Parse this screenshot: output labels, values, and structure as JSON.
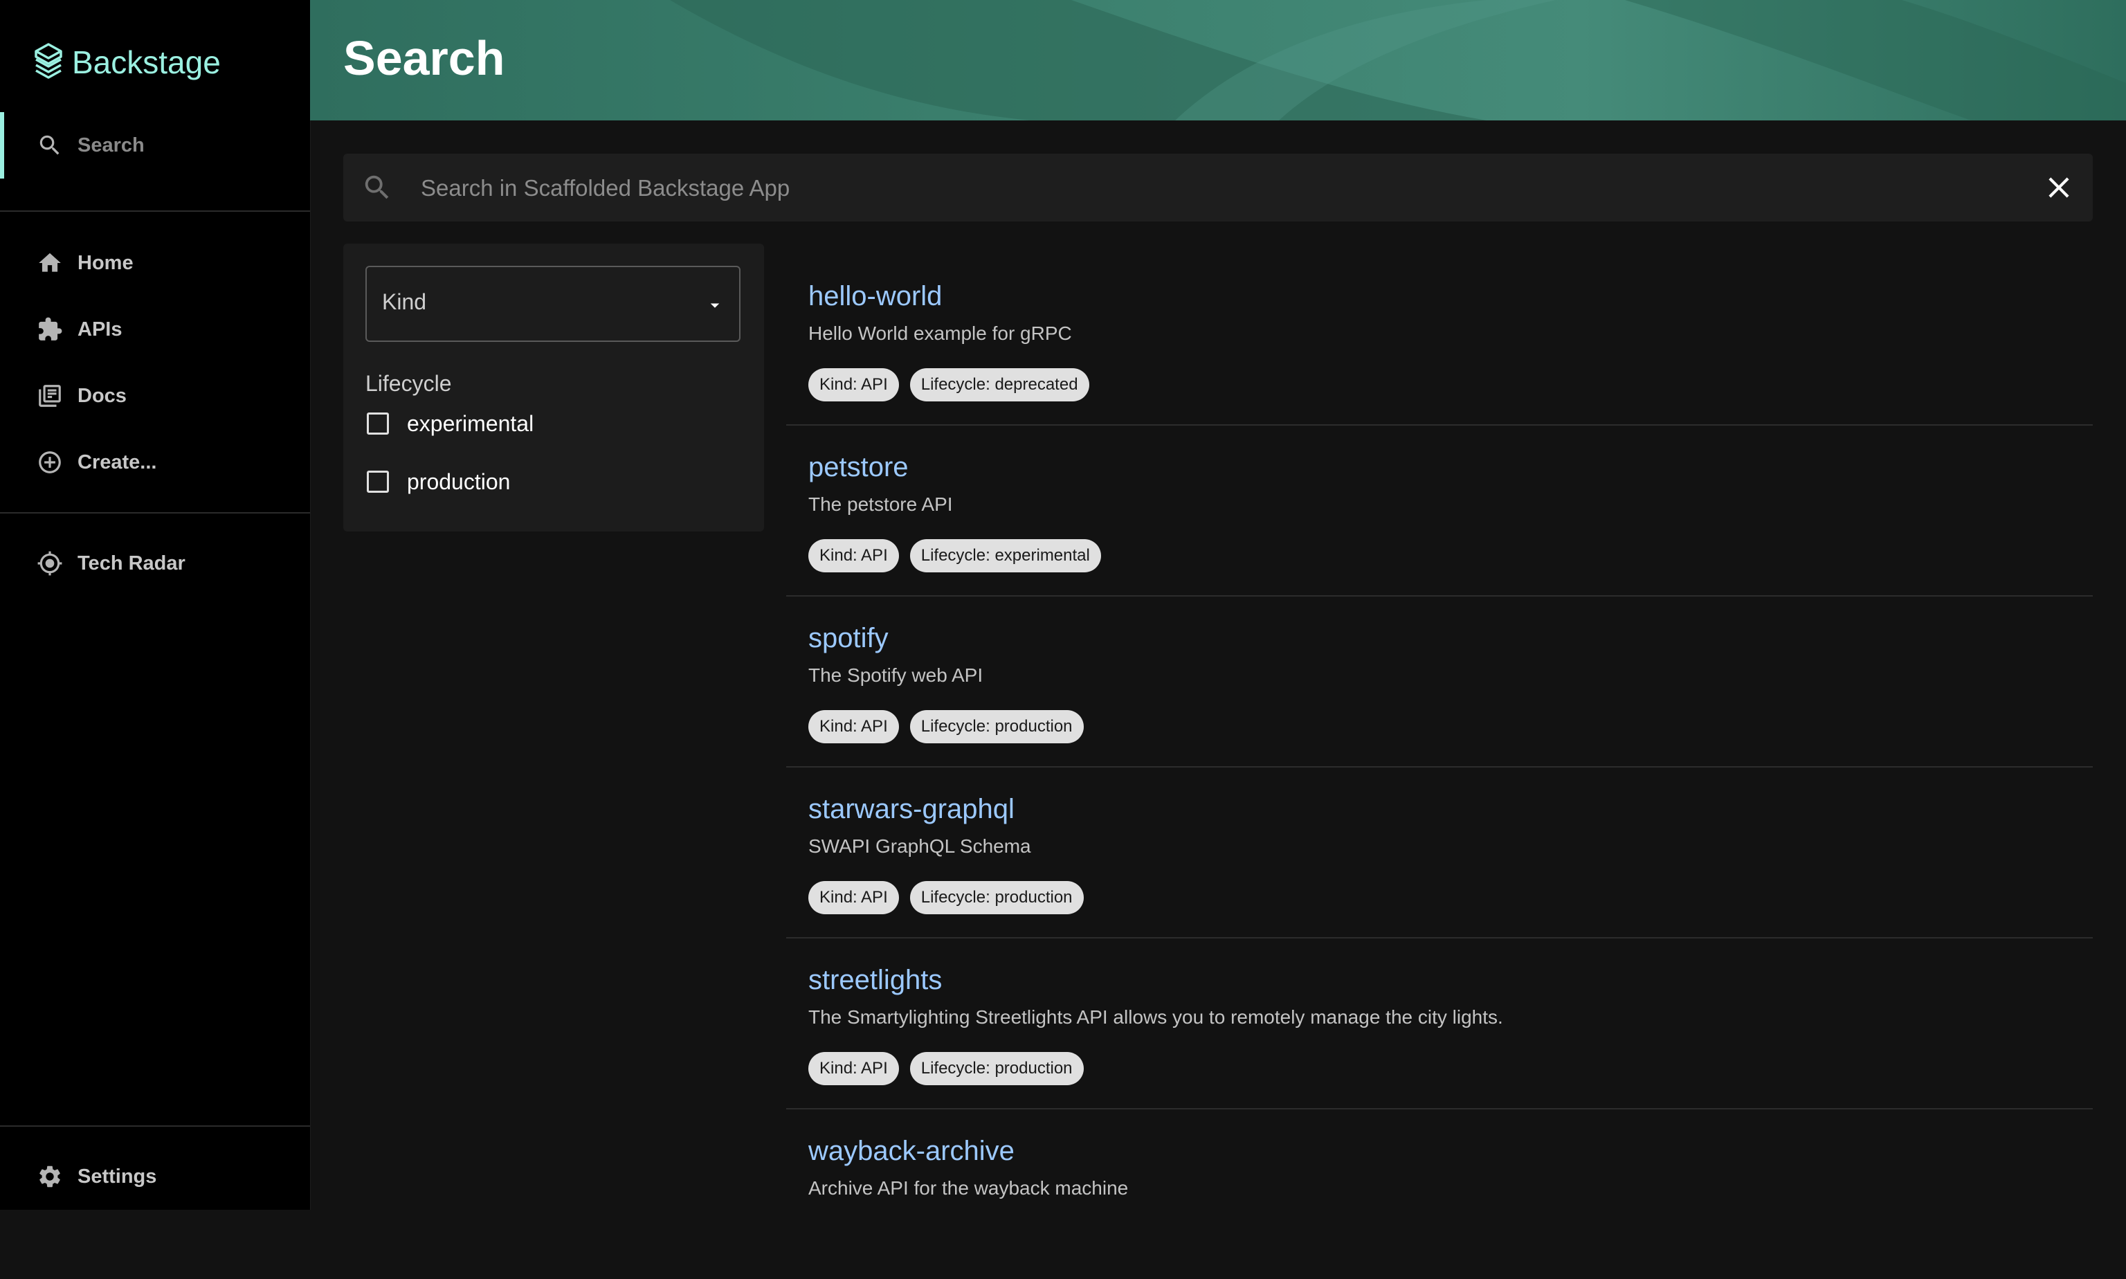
{
  "app": {
    "name": "Backstage"
  },
  "sidebar": {
    "search_label": "Search",
    "items": [
      {
        "label": "Home",
        "icon": "home-icon"
      },
      {
        "label": "APIs",
        "icon": "puzzle-icon"
      },
      {
        "label": "Docs",
        "icon": "library-books-icon"
      },
      {
        "label": "Create...",
        "icon": "add-circle-icon"
      },
      {
        "label": "Tech Radar",
        "icon": "radar-icon"
      }
    ],
    "settings_label": "Settings"
  },
  "header": {
    "title": "Search"
  },
  "search": {
    "placeholder": "Search in Scaffolded Backstage App",
    "value": ""
  },
  "filters": {
    "kind_label": "Kind",
    "lifecycle_title": "Lifecycle",
    "lifecycle_options": [
      "experimental",
      "production"
    ]
  },
  "results": [
    {
      "title": "hello-world",
      "description": "Hello World example for gRPC",
      "kind": "Kind: API",
      "lifecycle": "Lifecycle: deprecated"
    },
    {
      "title": "petstore",
      "description": "The petstore API",
      "kind": "Kind: API",
      "lifecycle": "Lifecycle: experimental"
    },
    {
      "title": "spotify",
      "description": "The Spotify web API",
      "kind": "Kind: API",
      "lifecycle": "Lifecycle: production"
    },
    {
      "title": "starwars-graphql",
      "description": "SWAPI GraphQL Schema",
      "kind": "Kind: API",
      "lifecycle": "Lifecycle: production"
    },
    {
      "title": "streetlights",
      "description": "The Smartylighting Streetlights API allows you to remotely manage the city lights.",
      "kind": "Kind: API",
      "lifecycle": "Lifecycle: production"
    },
    {
      "title": "wayback-archive",
      "description": "Archive API for the wayback machine",
      "kind": "",
      "lifecycle": ""
    }
  ],
  "colors": {
    "accent": "#9bf0e1",
    "link": "#9cc9ff",
    "header": "#3a7e6c",
    "background": "#121212",
    "sidebar": "#000000"
  }
}
